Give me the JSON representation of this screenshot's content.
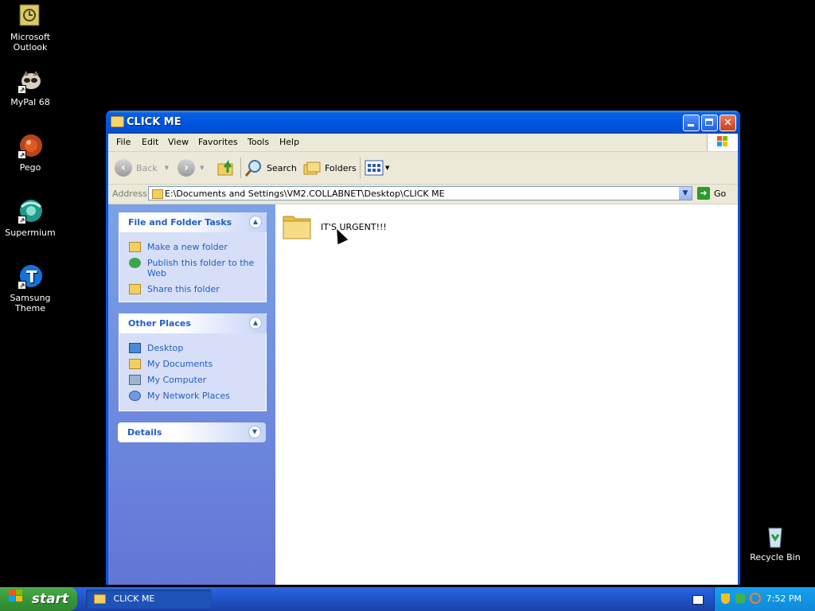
{
  "desktop": {
    "icons": [
      {
        "label": "Microsoft Outlook"
      },
      {
        "label": "MyPal 68"
      },
      {
        "label": "Pego"
      },
      {
        "label": "Supermium"
      },
      {
        "label": "Samsung Theme"
      },
      {
        "label": "Recycle Bin"
      }
    ]
  },
  "window": {
    "title": "CLICK ME",
    "menu": [
      "File",
      "Edit",
      "View",
      "Favorites",
      "Tools",
      "Help"
    ],
    "toolbar": {
      "back": "Back",
      "search": "Search",
      "folders": "Folders"
    },
    "address": {
      "label": "Address",
      "value": "E:\\Documents and Settings\\VM2.COLLABNET\\Desktop\\CLICK ME",
      "go": "Go"
    },
    "taskpane": {
      "file_tasks": {
        "title": "File and Folder Tasks",
        "items": [
          "Make a new folder",
          "Publish this folder to the Web",
          "Share this folder"
        ]
      },
      "other_places": {
        "title": "Other Places",
        "items": [
          "Desktop",
          "My Documents",
          "My Computer",
          "My Network Places"
        ]
      },
      "details": {
        "title": "Details"
      }
    },
    "files": [
      {
        "name": "IT'S URGENT!!!"
      }
    ]
  },
  "taskbar": {
    "start": "start",
    "task": "CLICK ME",
    "clock": "7:52 PM"
  },
  "colors": {
    "accent": "#0054e3",
    "taskpane_link": "#215dc6",
    "start_green": "#3b9b3b"
  }
}
